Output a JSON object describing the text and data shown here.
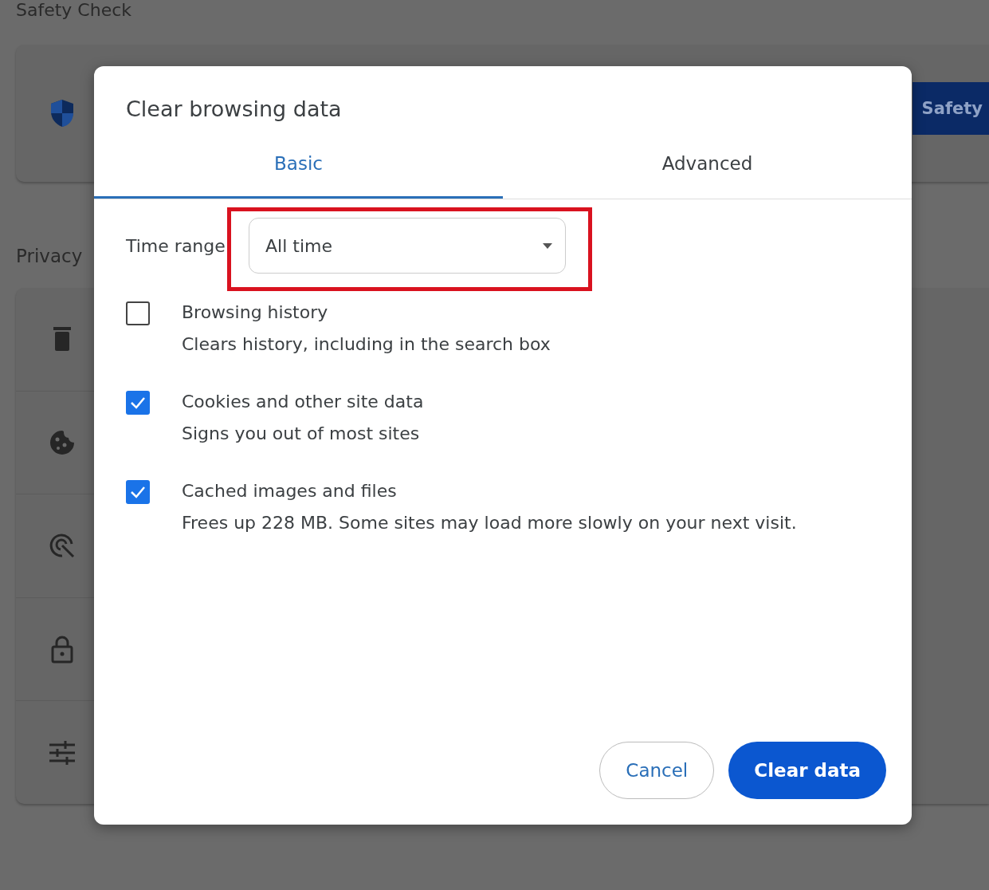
{
  "background": {
    "safety_heading": "Safety Check",
    "safety_button": "Safety",
    "privacy_heading": "Privacy",
    "privacy_rows": [
      {
        "kind": "trash"
      },
      {
        "kind": "cookie"
      },
      {
        "kind": "target"
      },
      {
        "kind": "lock"
      },
      {
        "kind": "sliders"
      }
    ]
  },
  "dialog": {
    "title": "Clear browsing data",
    "tabs": [
      {
        "label": "Basic",
        "selected": true
      },
      {
        "label": "Advanced",
        "selected": false
      }
    ],
    "time_range": {
      "label": "Time range",
      "value": "All time",
      "highlighted": true
    },
    "options": [
      {
        "title": "Browsing history",
        "description": "Clears history, including in the search box",
        "checked": false
      },
      {
        "title": "Cookies and other site data",
        "description": "Signs you out of most sites",
        "checked": true
      },
      {
        "title": "Cached images and files",
        "description": "Frees up 228 MB. Some sites may load more slowly on your next visit.",
        "checked": true
      }
    ],
    "buttons": [
      {
        "label": "Cancel",
        "kind": "secondary"
      },
      {
        "label": "Clear data",
        "kind": "primary"
      }
    ]
  }
}
